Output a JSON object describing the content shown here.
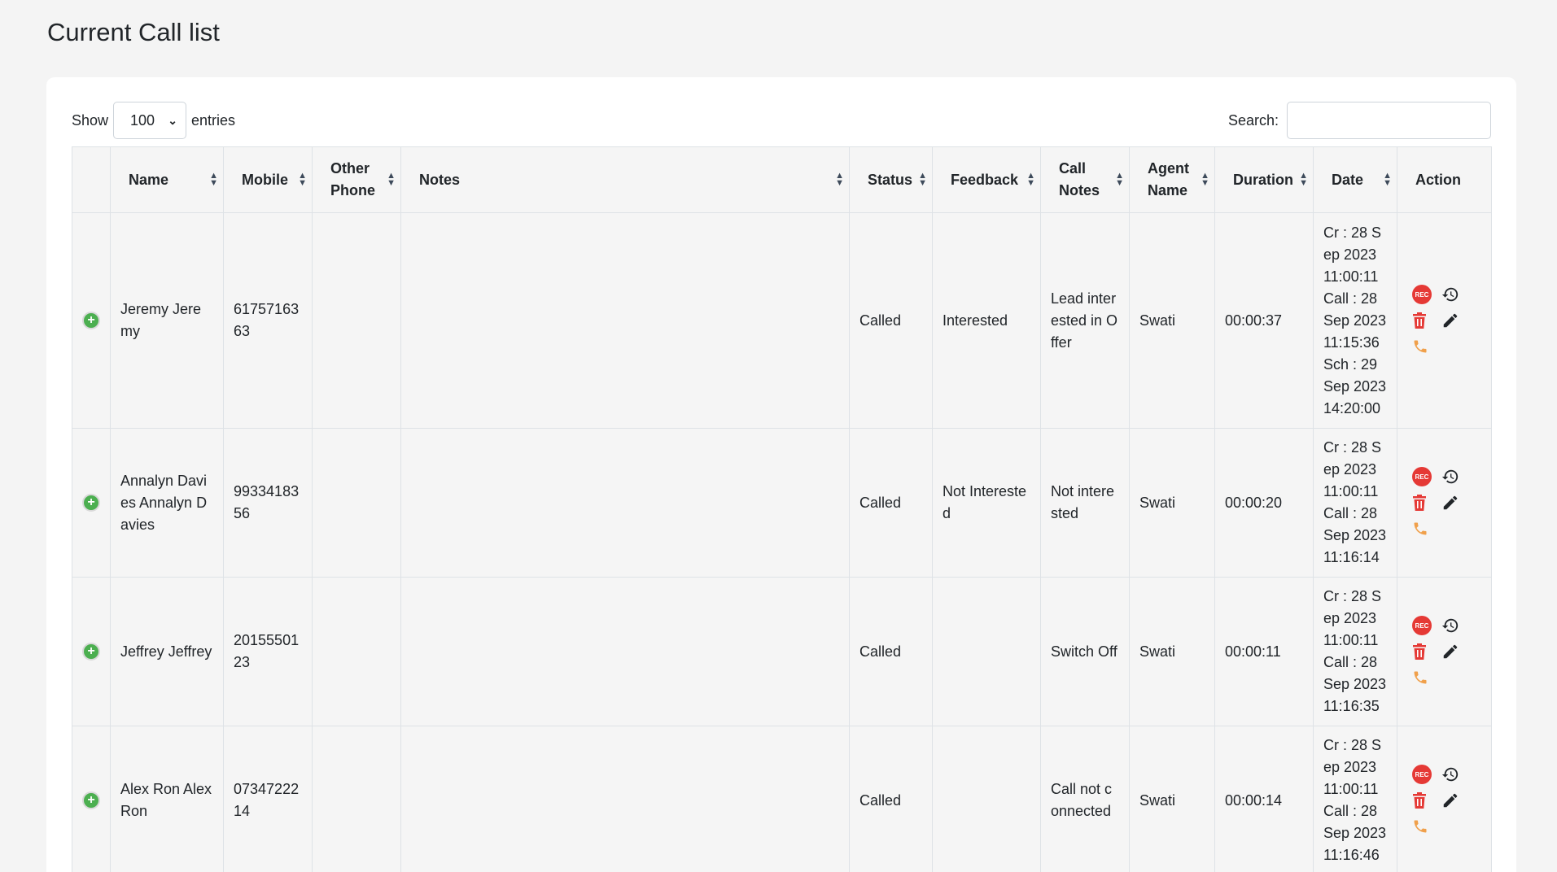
{
  "page": {
    "title": "Current Call list"
  },
  "controls": {
    "show_label": "Show",
    "entries_value": "100",
    "entries_label": "entries",
    "search_label": "Search:",
    "search_value": ""
  },
  "table": {
    "headers": [
      "",
      "Name",
      "Mobile",
      "Other Phone",
      "Notes",
      "Status",
      "Feedback",
      "Call Notes",
      "Agent Name",
      "Duration",
      "Date",
      "Action"
    ],
    "rows": [
      {
        "name": "Jeremy Jeremy",
        "mobile": "6175716363",
        "other_phone": "",
        "notes": "",
        "status": "Called",
        "feedback": "Interested",
        "call_notes": "Lead interested in Offer",
        "agent": "Swati",
        "duration": "00:00:37",
        "date": "Cr : 28 Sep 2023 11:00:11 Call : 28 Sep 2023 11:15:36 Sch : 29 Sep 2023 14:20:00"
      },
      {
        "name": "Annalyn Davies Annalyn Davies",
        "mobile": "9933418356",
        "other_phone": "",
        "notes": "",
        "status": "Called",
        "feedback": "Not Interested",
        "call_notes": "Not interested",
        "agent": "Swati",
        "duration": "00:00:20",
        "date": "Cr : 28 Sep 2023 11:00:11 Call : 28 Sep 2023 11:16:14"
      },
      {
        "name": "Jeffrey Jeffrey",
        "mobile": "2015550123",
        "other_phone": "",
        "notes": "",
        "status": "Called",
        "feedback": "",
        "call_notes": "Switch Off",
        "agent": "Swati",
        "duration": "00:00:11",
        "date": "Cr : 28 Sep 2023 11:00:11 Call : 28 Sep 2023 11:16:35"
      },
      {
        "name": "Alex Ron Alex Ron",
        "mobile": "0734722214",
        "other_phone": "",
        "notes": "",
        "status": "Called",
        "feedback": "",
        "call_notes": "Call not connected",
        "agent": "Swati",
        "duration": "00:00:14",
        "date": "Cr : 28 Sep 2023 11:00:11 Call : 28 Sep 2023 11:16:46"
      }
    ]
  },
  "icons": {
    "expand": "plus-circle-icon",
    "recording": "rec-icon",
    "history": "history-icon",
    "delete": "trash-icon",
    "edit": "pencil-icon",
    "call": "phone-icon",
    "sort": "sort-icon"
  },
  "colors": {
    "rec": "#e53935",
    "delete": "#e53935",
    "call": "#f0a04b",
    "expand": "#4caf50"
  },
  "action_icons": {
    "rec_text": "REC"
  }
}
